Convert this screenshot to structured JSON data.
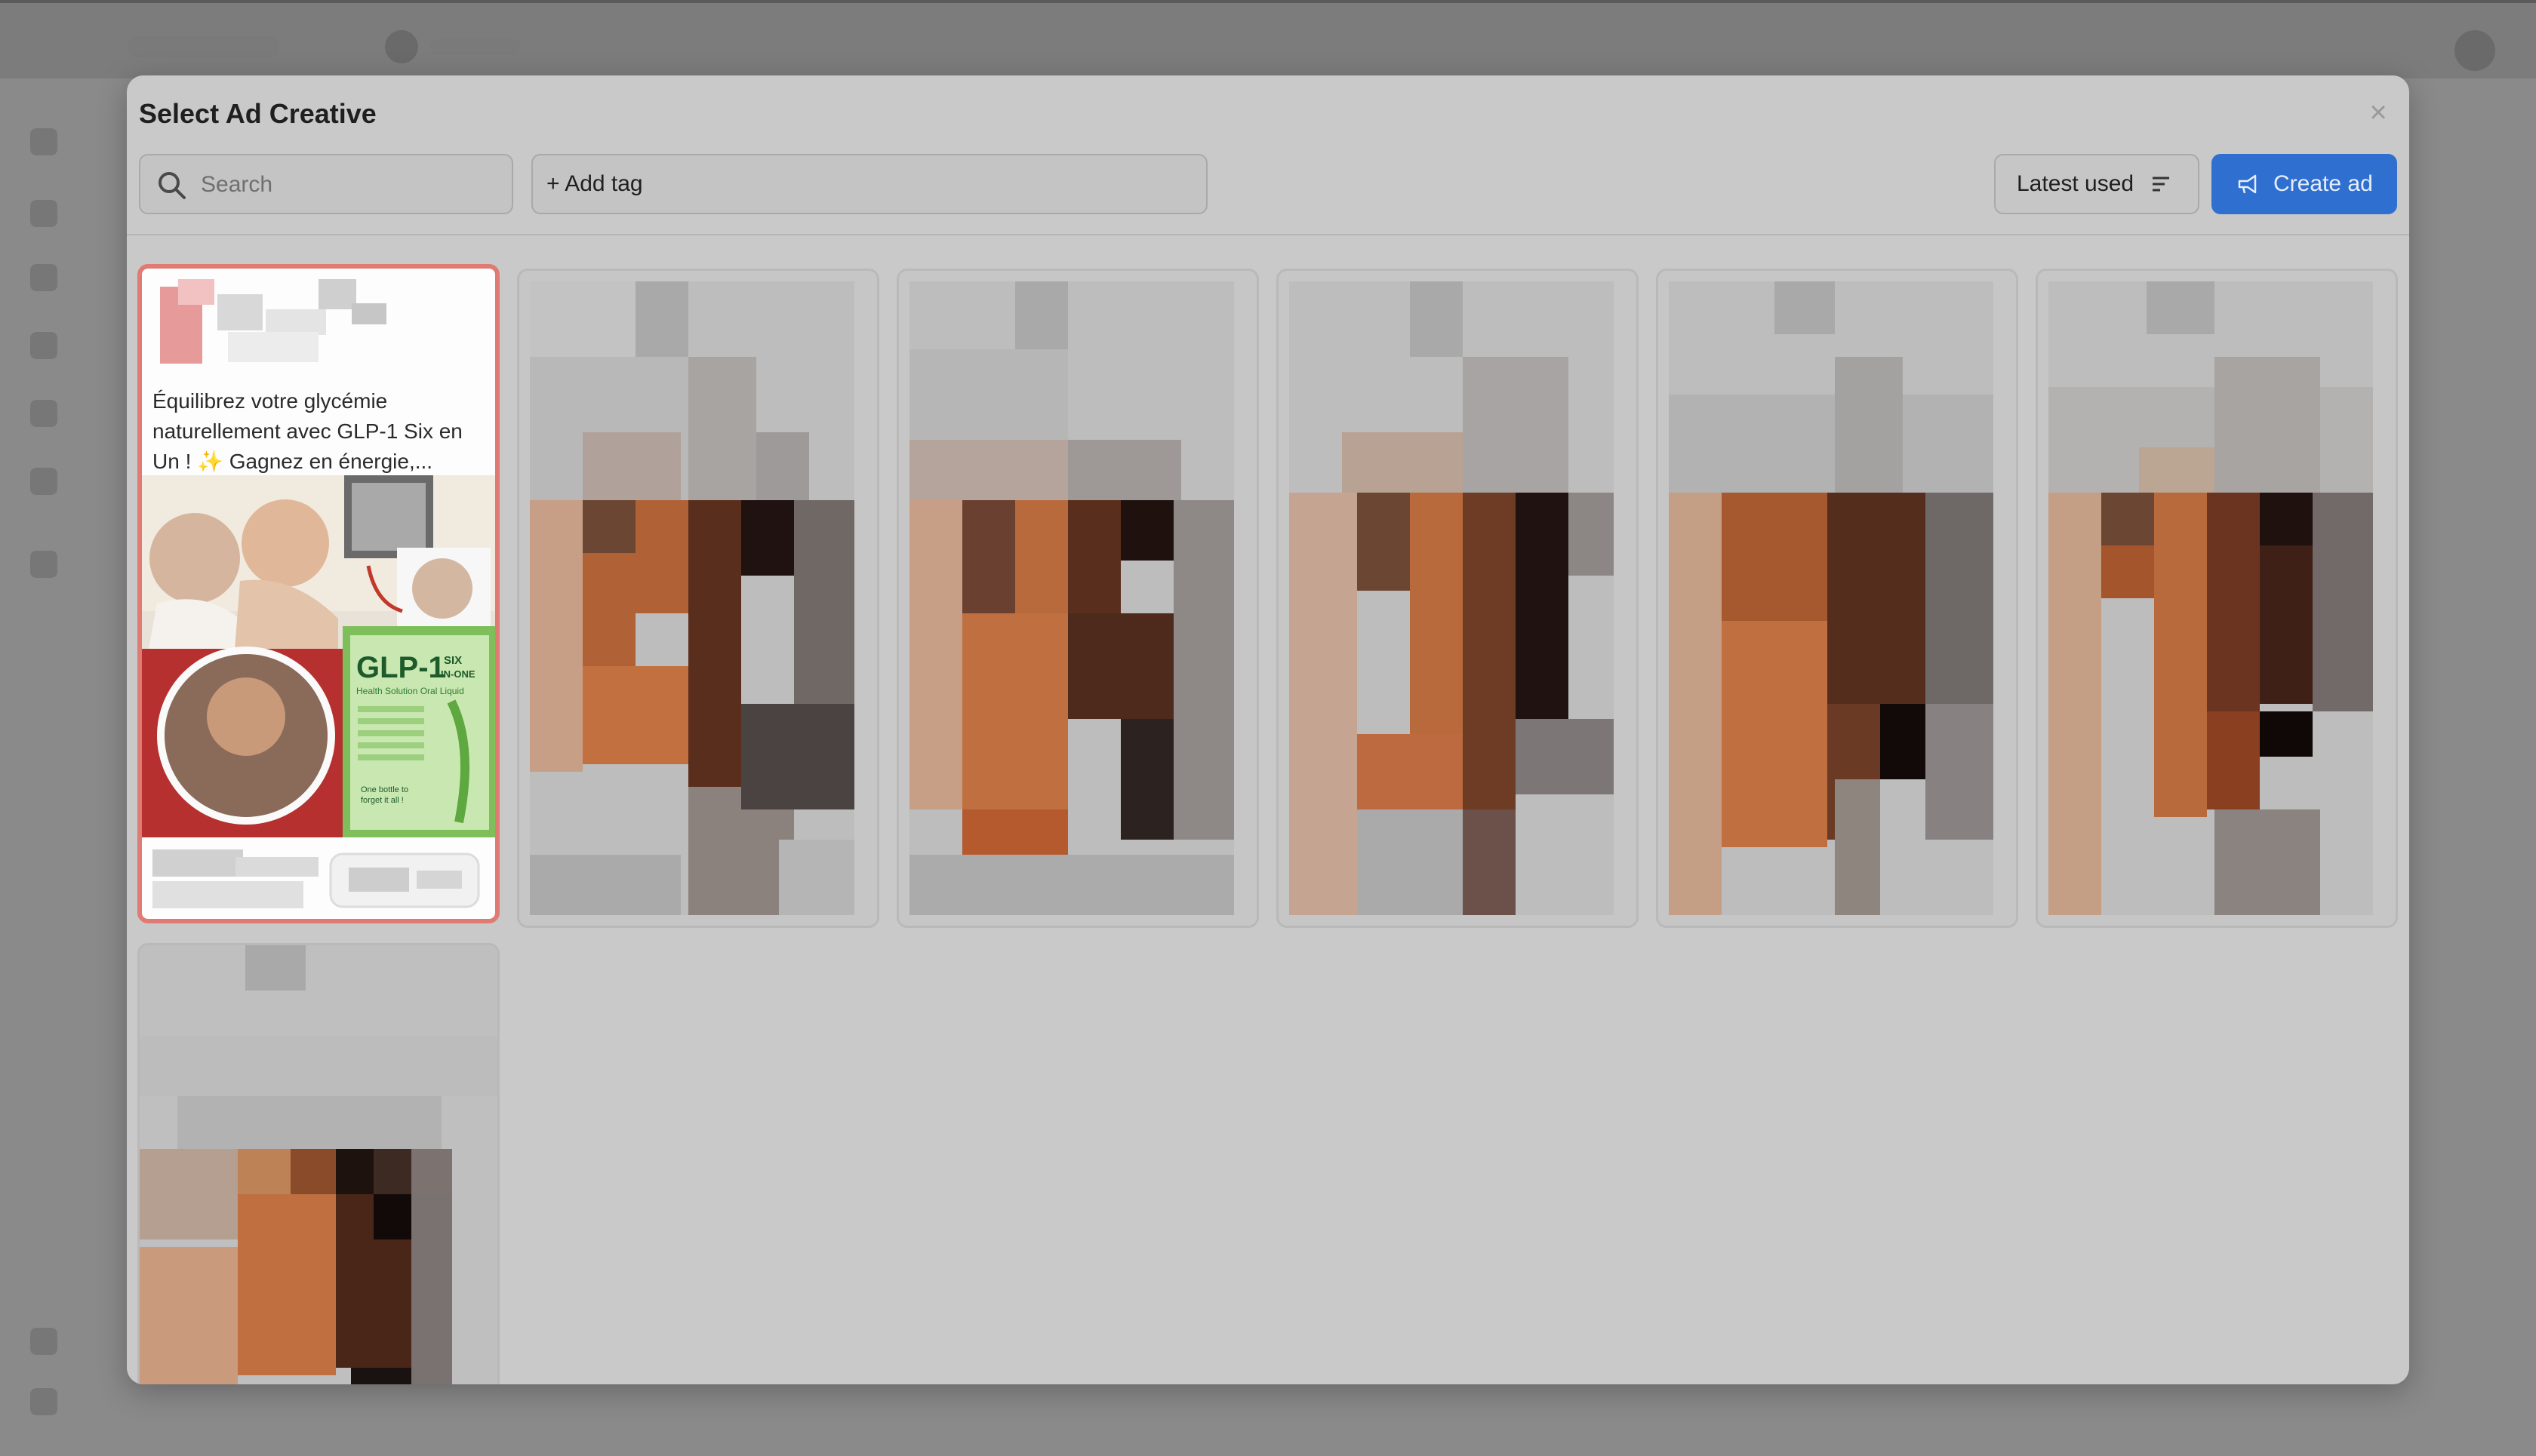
{
  "modal": {
    "title": "Select Ad Creative",
    "close_icon": "close-icon"
  },
  "toolbar": {
    "search_placeholder": "Search",
    "add_tag_label": "+ Add tag",
    "sort_label": "Latest used",
    "create_label": "Create ad"
  },
  "cards": [
    {
      "selected": true,
      "text": "Équilibrez votre glycémie naturellement avec GLP-1 Six en Un ! ✨ Gagnez en énergie,...",
      "product": {
        "name": "GLP-1",
        "tagline_top": "SIX",
        "tagline_bottom": "IN-ONE",
        "subtitle": "Health Solution Oral Liquid",
        "slogan_line1": "One bottle to",
        "slogan_line2": "forget it all !"
      }
    },
    {
      "selected": false
    },
    {
      "selected": false
    },
    {
      "selected": false
    },
    {
      "selected": false
    },
    {
      "selected": false
    },
    {
      "selected": false
    }
  ],
  "colors": {
    "accent": "#2f6fd0",
    "selected_border": "#e07b73",
    "modal_bg": "#c9c9c9"
  }
}
